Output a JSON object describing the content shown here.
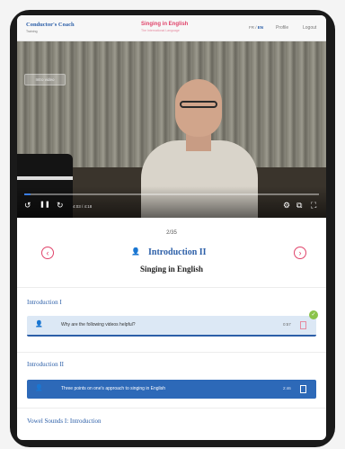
{
  "header": {
    "logo_title": "Conductor's Coach",
    "logo_subtitle": "Training",
    "page_title": "Singing in English",
    "page_subtitle": "The International Language",
    "lang_prefix": "FR / ",
    "lang_active": "EN",
    "profile_label": "Profile",
    "logout_label": "Logout"
  },
  "video": {
    "overlay_button": "Intro video",
    "progress": 0.02,
    "time": "4:03 / 4:18",
    "replay_icon": "↺",
    "pause_icon": "❚❚",
    "forward_icon": "↻",
    "settings_icon": "⚙",
    "pip_icon": "⧉",
    "fullscreen_icon": "⛶"
  },
  "lesson": {
    "counter": "2/35",
    "prev_icon": "‹",
    "next_icon": "›",
    "icon": "👤",
    "title": "Introduction II",
    "subtitle": "Singing in English"
  },
  "sections": [
    {
      "heading": "Introduction I",
      "item": {
        "icon": "👤",
        "text": "Why are the following videos helpful?",
        "duration": "0:57"
      }
    },
    {
      "heading": "Introduction II",
      "item": {
        "icon": "👤",
        "text": "Three points on one's approach to singing in English",
        "duration": "2:46"
      }
    },
    {
      "heading": "Vowel Sounds I: Introduction"
    }
  ],
  "check_icon": "✓",
  "colors": {
    "brand_blue": "#2c5fa8",
    "accent_pink": "#e0436a",
    "active_row": "#2d69b8",
    "visited_row": "#dce8f5",
    "done_green": "#8bc34a"
  }
}
